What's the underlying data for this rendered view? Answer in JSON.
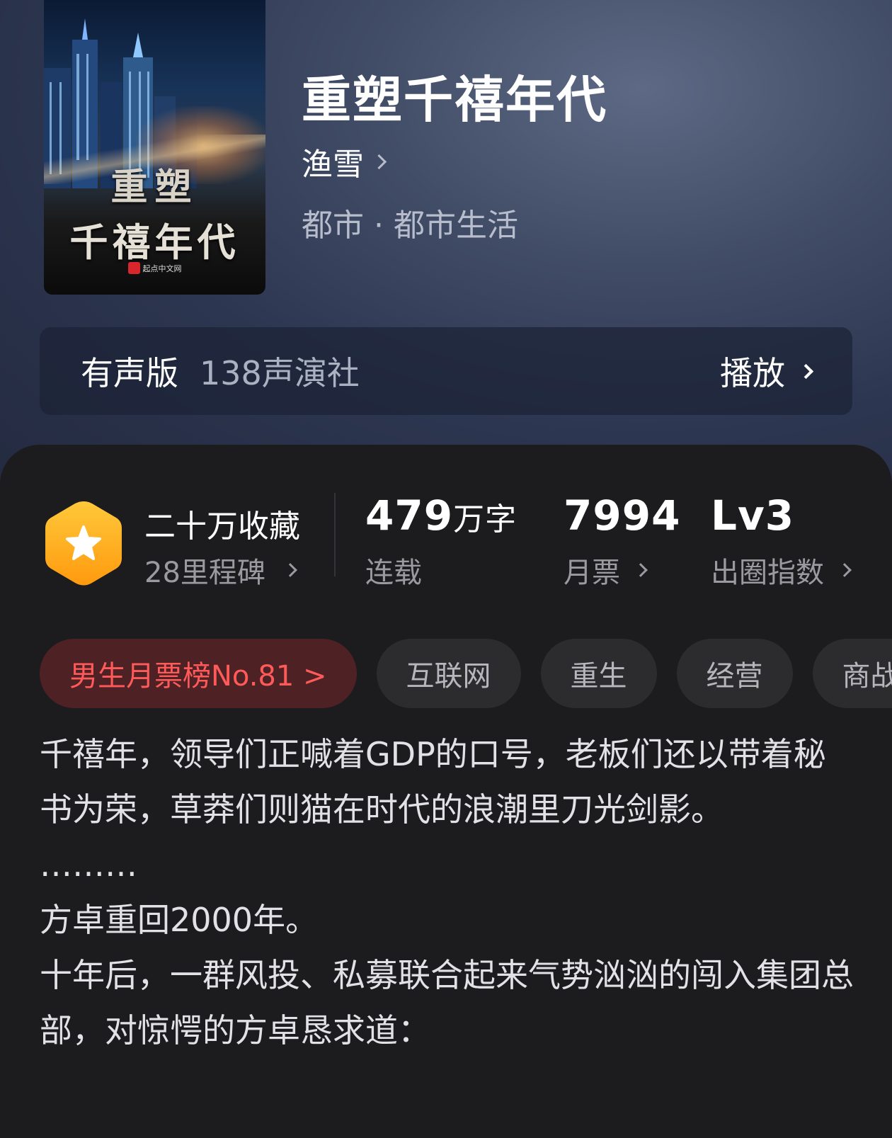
{
  "book": {
    "cover_title_line1": "重塑",
    "cover_title_line2": "千禧年代",
    "cover_publisher": "起点中文网",
    "title": "重塑千禧年代",
    "author": "渔雪",
    "genre": "都市 · 都市生活"
  },
  "audio": {
    "label": "有声版",
    "studio": "138声演社",
    "play_label": "播放"
  },
  "stats": {
    "favorites": "二十万收藏",
    "milestones": "28里程碑",
    "word_count_value": "479",
    "word_count_unit": "万字",
    "status": "连载",
    "monthly_tickets": "7994",
    "monthly_tickets_label": "月票",
    "circle_index": "Lv3",
    "circle_index_label": "出圈指数"
  },
  "tags": [
    "男生月票榜No.81 >",
    "互联网",
    "重生",
    "经营",
    "商战"
  ],
  "synopsis": [
    "千禧年，领导们正喊着GDP的口号，老板们还以带着秘书为荣，草莽们则猫在时代的浪潮里刀光剑影。",
    "………",
    "方卓重回2000年。",
    "十年后，一群风投、私募联合起来气势汹汹的闯入集团总部，对惊愕的方卓恳求道："
  ],
  "colors": {
    "hero_bg": "#3a4560",
    "panel_bg": "#1c1c1e",
    "badge_orange": "#ffb21e",
    "rank_tag_bg": "#4e2124",
    "rank_tag_text": "#ff5a5a"
  }
}
